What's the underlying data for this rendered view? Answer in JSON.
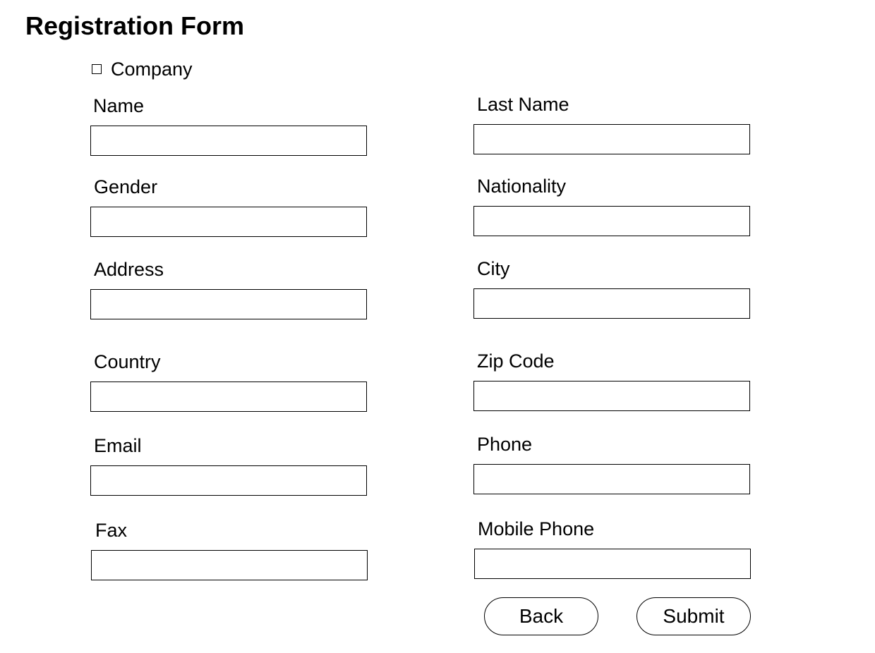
{
  "form": {
    "title": "Registration Form",
    "company_checkbox": {
      "label": "Company",
      "checked": false
    },
    "fields": {
      "name": {
        "label": "Name",
        "value": ""
      },
      "last_name": {
        "label": "Last Name",
        "value": ""
      },
      "gender": {
        "label": "Gender",
        "value": ""
      },
      "nationality": {
        "label": "Nationality",
        "value": ""
      },
      "address": {
        "label": "Address",
        "value": ""
      },
      "city": {
        "label": "City",
        "value": ""
      },
      "country": {
        "label": "Country",
        "value": ""
      },
      "zip_code": {
        "label": "Zip Code",
        "value": ""
      },
      "email": {
        "label": "Email",
        "value": ""
      },
      "phone": {
        "label": "Phone",
        "value": ""
      },
      "fax": {
        "label": "Fax",
        "value": ""
      },
      "mobile_phone": {
        "label": "Mobile Phone",
        "value": ""
      }
    },
    "buttons": {
      "back_label": "Back",
      "submit_label": "Submit"
    }
  }
}
